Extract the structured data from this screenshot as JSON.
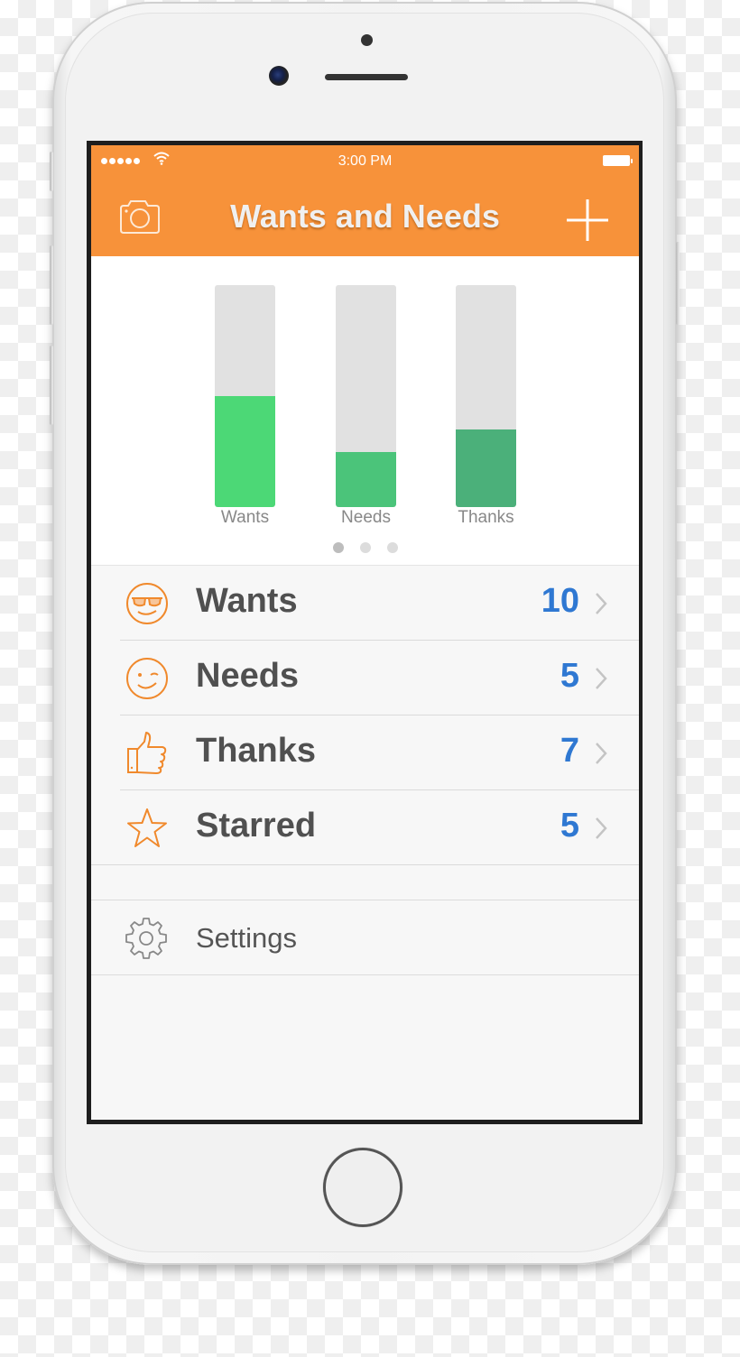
{
  "status_bar": {
    "time": "3:00 PM",
    "signal_bars": 5,
    "wifi_icon": "wifi-icon",
    "battery_icon": "battery-icon"
  },
  "navbar": {
    "title": "Wants and Needs",
    "left_icon": "camera-icon",
    "right_icon": "plus-icon"
  },
  "colors": {
    "accent": "#f7923a",
    "count_blue": "#2f78d2",
    "icon_orange": "#f0892c",
    "bar_track": "#e1e1e1"
  },
  "chart_data": {
    "type": "bar",
    "categories": [
      "Wants",
      "Needs",
      "Thanks"
    ],
    "values": [
      10,
      5,
      7
    ],
    "fractions": [
      0.5,
      0.25,
      0.35
    ],
    "colors": [
      "#4cd876",
      "#4bc47a",
      "#4bb07a"
    ],
    "ylim": [
      0,
      20
    ],
    "title": "",
    "xlabel": "",
    "ylabel": ""
  },
  "pager": {
    "count": 3,
    "active": 0
  },
  "list": {
    "items": [
      {
        "label": "Wants",
        "count": "10",
        "icon": "sunglasses-smiley-icon"
      },
      {
        "label": "Needs",
        "count": "5",
        "icon": "winking-smiley-icon"
      },
      {
        "label": "Thanks",
        "count": "7",
        "icon": "thumbs-up-icon"
      },
      {
        "label": "Starred",
        "count": "5",
        "icon": "star-icon"
      }
    ]
  },
  "settings": {
    "label": "Settings",
    "icon": "gear-icon"
  }
}
